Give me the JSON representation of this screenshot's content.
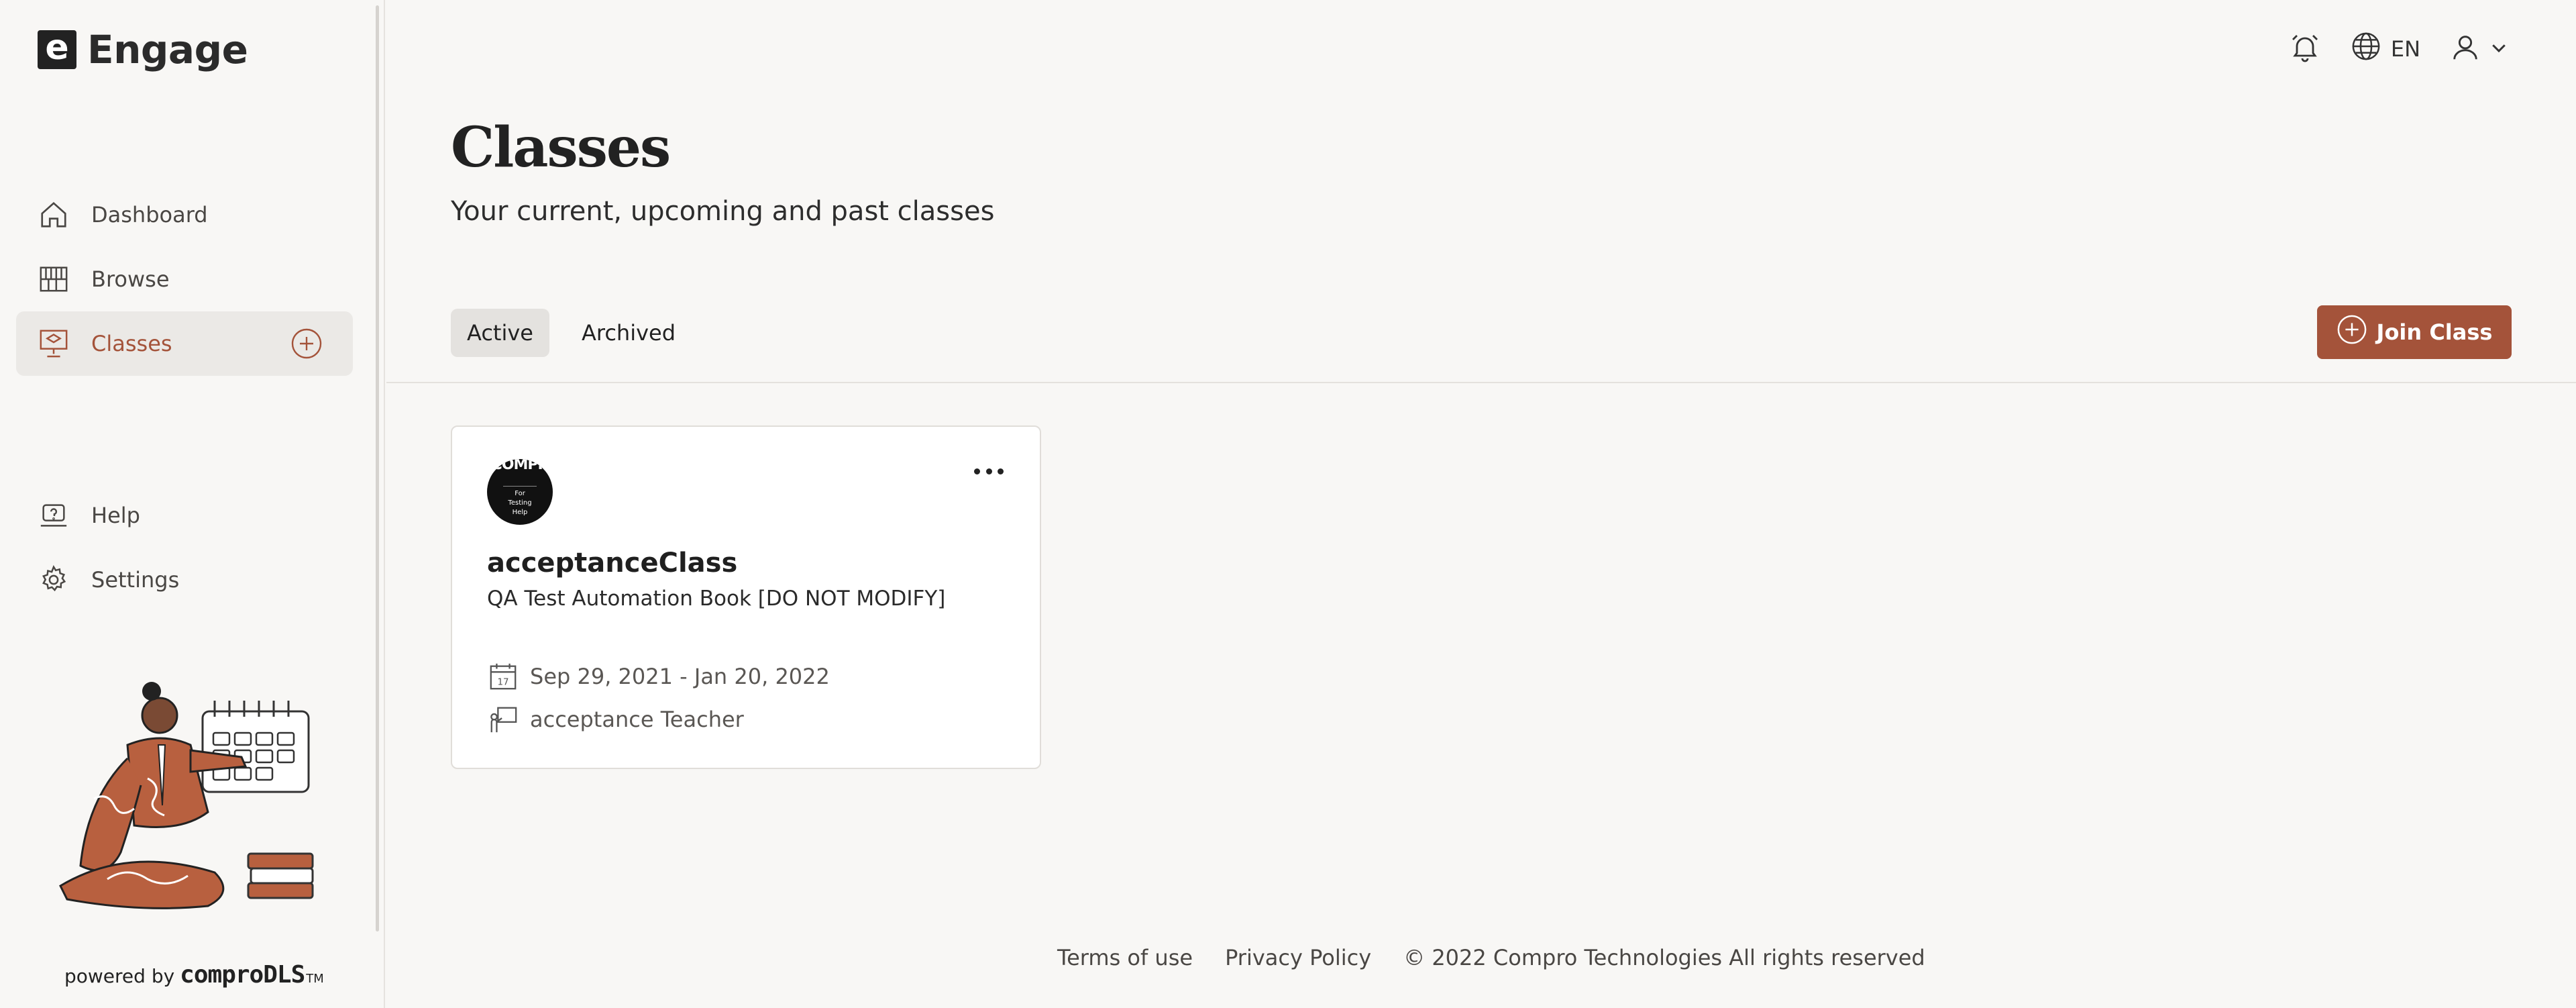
{
  "brand": {
    "logo_letter": "e",
    "name": "Engage"
  },
  "nav": {
    "items": [
      {
        "label": "Dashboard",
        "icon": "home-icon"
      },
      {
        "label": "Browse",
        "icon": "bookshelf-icon"
      },
      {
        "label": "Classes",
        "icon": "classroom-icon",
        "active": true
      }
    ],
    "secondary": [
      {
        "label": "Help",
        "icon": "help-icon"
      },
      {
        "label": "Settings",
        "icon": "gear-icon"
      }
    ]
  },
  "footer_brand": {
    "powered_by": "powered by",
    "product": "comproDLS",
    "tm": "TM"
  },
  "topbar": {
    "language": "EN"
  },
  "page": {
    "title": "Classes",
    "subtitle": "Your current, upcoming and past classes"
  },
  "tabs": [
    {
      "label": "Active",
      "active": true
    },
    {
      "label": "Archived",
      "active": false
    }
  ],
  "join_button": {
    "label": "Join Class"
  },
  "class_card": {
    "avatar_text_top": "COMPR",
    "avatar_text_box": "For Testing Help",
    "title": "acceptanceClass",
    "book": "QA Test Automation Book [DO NOT MODIFY]",
    "dates": "Sep 29, 2021 - Jan 20, 2022",
    "calendar_day": "17",
    "teacher": "acceptance Teacher"
  },
  "footer": {
    "terms": "Terms of use",
    "privacy": "Privacy Policy",
    "copyright": "© 2022 Compro Technologies All rights reserved"
  },
  "colors": {
    "accent": "#a4533a",
    "background": "#f8f7f5",
    "active_nav_bg": "#ebe9e6"
  }
}
